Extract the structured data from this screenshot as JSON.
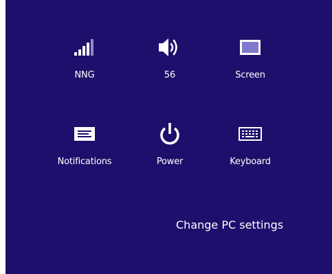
{
  "colors": {
    "background": "#1d0f6b",
    "foreground": "#ffffff",
    "screen_icon_fill": "#7f7acd"
  },
  "tiles": [
    {
      "label": "NNG",
      "icon": "wifi-signal-icon"
    },
    {
      "label": "56",
      "icon": "volume-icon"
    },
    {
      "label": "Screen",
      "icon": "screen-icon"
    },
    {
      "label": "Notifications",
      "icon": "notifications-icon"
    },
    {
      "label": "Power",
      "icon": "power-icon"
    },
    {
      "label": "Keyboard",
      "icon": "keyboard-icon"
    }
  ],
  "change_pc_settings": "Change PC settings"
}
